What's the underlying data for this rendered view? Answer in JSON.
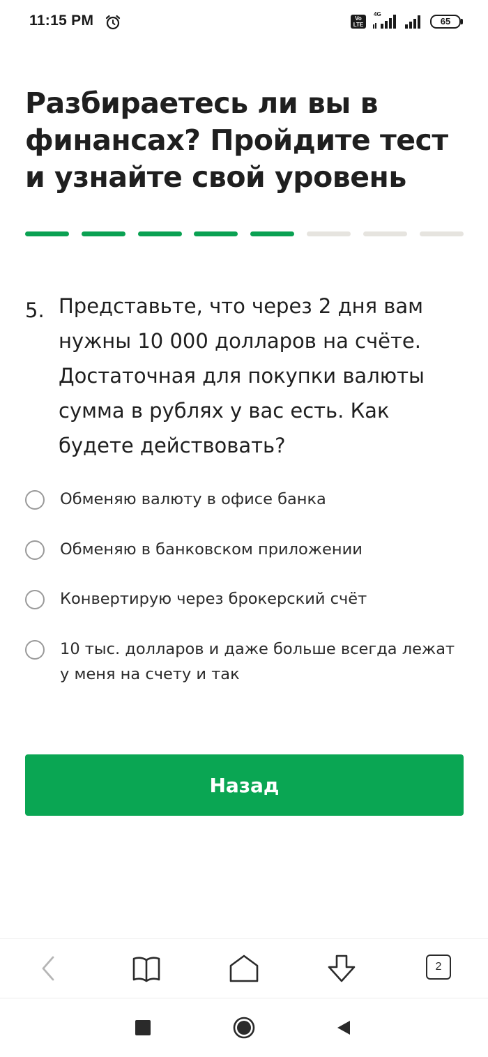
{
  "status_bar": {
    "time": "11:15 PM",
    "volte_line1": "Vo",
    "volte_line2": "LTE",
    "network": "4G",
    "battery": "65"
  },
  "title": "Разбираетесь ли вы в финансах? Пройдите тест и узнайте свой уровень",
  "progress": {
    "current": 5,
    "total": 8
  },
  "question": {
    "number": "5.",
    "text": "Представьте, что через 2 дня вам нужны 10 000 долларов на счёте. Достаточная для покупки валюты сумма в рублях у вас есть. Как будете действовать?"
  },
  "options": [
    "Обменяю валюту в офисе банка",
    "Обменяю в банковском приложении",
    "Конвертирую через брокерский счёт",
    "10 тыс. долларов и даже больше всегда лежат у меня на счету и так"
  ],
  "back_button": "Назад",
  "browser_toolbar": {
    "tabs_count": "2"
  },
  "colors": {
    "accent": "#0aa653",
    "progress_done": "#0aa152",
    "progress_todo": "#e6e4df"
  }
}
